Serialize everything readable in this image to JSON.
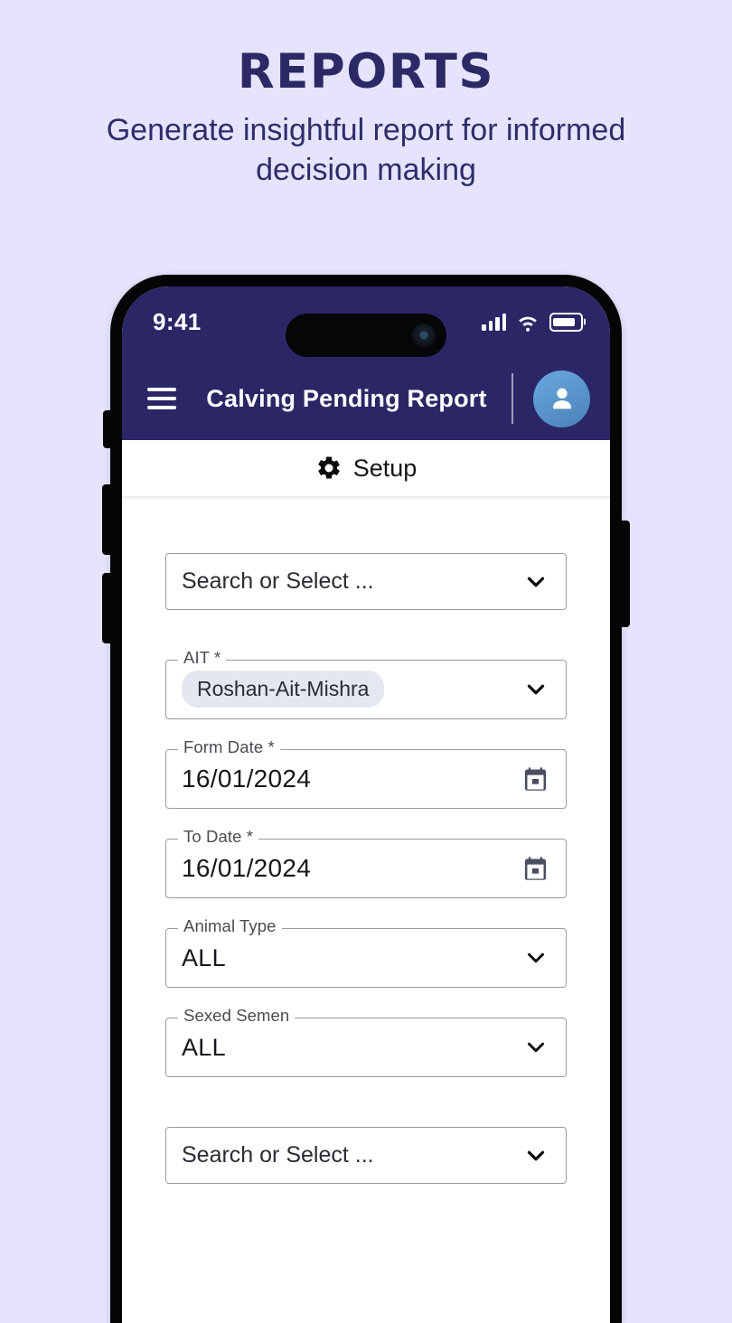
{
  "promo": {
    "title": "REPORTS",
    "subtitle": "Generate insightful report for informed decision making"
  },
  "colors": {
    "page_background": "#E5E4FC",
    "brand_navy": "#2B2767",
    "promo_title": "#2B2A66",
    "avatar_blue": "#5B9BD5",
    "chip_background": "#E3E7EF",
    "field_border": "#9A9AA2"
  },
  "phone": {
    "status_bar": {
      "time": "9:41",
      "signal_icon": "cellular-signal-icon",
      "wifi_icon": "wifi-icon",
      "battery_icon": "battery-icon"
    },
    "app_bar": {
      "menu_icon": "hamburger-menu-icon",
      "title": "Calving Pending Report",
      "avatar_icon": "user-avatar-icon"
    },
    "tab": {
      "icon": "gear-icon",
      "label": "Setup"
    },
    "form": {
      "fields": [
        {
          "name": "top-search-select",
          "label": "",
          "placeholder": "Search or Select ...",
          "value": "",
          "trailing_icon": "chevron-down-icon"
        },
        {
          "name": "ait",
          "label": "AIT *",
          "placeholder": "",
          "value": "Roshan-Ait-Mishra",
          "trailing_icon": "chevron-down-icon"
        },
        {
          "name": "form-date",
          "label": "Form Date *",
          "placeholder": "",
          "value": "16/01/2024",
          "trailing_icon": "calendar-icon"
        },
        {
          "name": "to-date",
          "label": "To Date *",
          "placeholder": "",
          "value": "16/01/2024",
          "trailing_icon": "calendar-icon"
        },
        {
          "name": "animal-type",
          "label": "Animal Type",
          "placeholder": "",
          "value": "ALL",
          "trailing_icon": "chevron-down-icon"
        },
        {
          "name": "sexed-semen",
          "label": "Sexed Semen",
          "placeholder": "",
          "value": "ALL",
          "trailing_icon": "chevron-down-icon"
        },
        {
          "name": "bottom-search-select",
          "label": "",
          "placeholder": "Search or Select ...",
          "value": "",
          "trailing_icon": "chevron-down-icon"
        }
      ]
    }
  }
}
